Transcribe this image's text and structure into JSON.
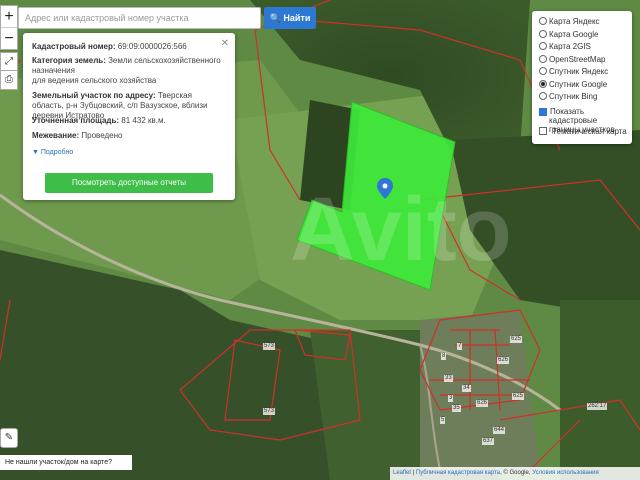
{
  "search": {
    "placeholder": "Адрес или кадастровый номер участка",
    "button": "Найти"
  },
  "info": {
    "cadastral_label": "Кадастровый номер:",
    "cadastral_value": "69:09:0000026:566",
    "category_label": "Категория земель:",
    "category_value": "Земли сельскохозяйственного назначения",
    "usage_value": "для ведения сельского хозяйства",
    "address_label": "Земельный участок по адресу:",
    "address_value": "Тверская область, р-н Зубцовский, с/п Вазузское, вблизи деревни Истратово",
    "area_label": "Уточненная площадь:",
    "area_value": "81 432 кв.м.",
    "survey_label": "Межевание:",
    "survey_value": "Проведено",
    "more_label": "Подробно",
    "reports_button": "Посмотреть доступные отчеты"
  },
  "layers": {
    "options": [
      {
        "label": "Карта Яндекс",
        "selected": false
      },
      {
        "label": "Карта Google",
        "selected": false
      },
      {
        "label": "Карта 2GIS",
        "selected": false
      },
      {
        "label": "OpenStreetMap",
        "selected": false
      },
      {
        "label": "Спутник Яндекс",
        "selected": false
      },
      {
        "label": "Спутник Google",
        "selected": true
      },
      {
        "label": "Спутник Bing",
        "selected": false
      }
    ],
    "checkbox_boundaries": "Показать кадастровые границы участков",
    "checkbox_boundaries_checked": true,
    "checkbox_thematic": "Тематическая карта",
    "checkbox_thematic_checked": false
  },
  "zoom": {
    "in": "+",
    "out": "−"
  },
  "parcel_labels": [
    "573",
    "573",
    "625",
    "626",
    "625",
    "644",
    "637",
    "262:17",
    "626",
    "33",
    "34",
    "35",
    "8",
    "7",
    "3",
    "5"
  ],
  "not_found": "Не нашли участок/дом на карте?",
  "attribution": {
    "leaflet": "Leaflet",
    "pkk": "Публичная кадастровая карта",
    "google": "© Google",
    "terms": "Условия использования"
  },
  "watermark": "Avito",
  "colors": {
    "parcel_fill": "#3ee83a",
    "boundary": "#d0302a",
    "button_blue": "#2d78d4",
    "button_green": "#3ebd48"
  }
}
